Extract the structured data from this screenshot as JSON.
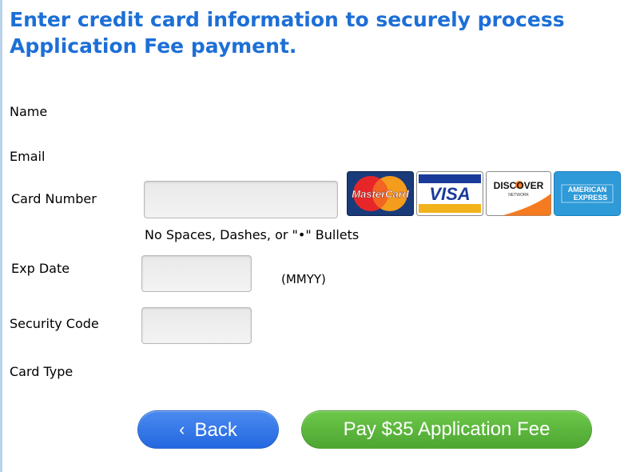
{
  "page": {
    "title": "Enter credit card information to securely process Application Fee payment."
  },
  "form": {
    "name_label": "Name",
    "email_label": "Email",
    "card_number_label": "Card Number",
    "card_number_value": "",
    "card_number_hint": "No Spaces, Dashes, or \"•\" Bullets",
    "exp_date_label": "Exp Date",
    "exp_date_value": "",
    "exp_date_format": "(MMYY)",
    "security_code_label": "Security Code",
    "security_code_value": "",
    "card_type_label": "Card Type"
  },
  "card_logos": {
    "mastercard": "MasterCard",
    "visa": "VISA",
    "discover": "DISCOVER",
    "discover_sub": "NETWORK",
    "amex_line1": "AMERICAN",
    "amex_line2": "EXPRESS"
  },
  "buttons": {
    "back_label": "Back",
    "back_icon": "chevron-left-icon",
    "pay_label": "Pay $35 Application Fee"
  },
  "colors": {
    "title": "#1d6fd6",
    "back_button": "#2f75e8",
    "pay_button": "#5bb63c"
  }
}
